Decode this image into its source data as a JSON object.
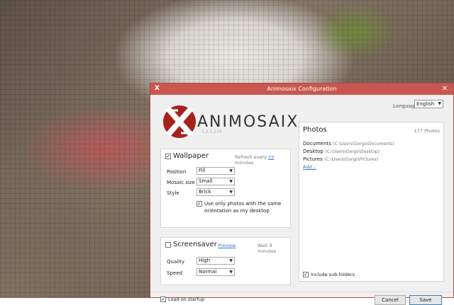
{
  "window": {
    "title": "Animosaix Configuration",
    "icon_label": "X",
    "close_label": "✕"
  },
  "language": {
    "label": "Language",
    "value": "English"
  },
  "logo": {
    "name": "ANIMOSAIX",
    "version": "1.2.1.174"
  },
  "wallpaper": {
    "checked": true,
    "title": "Wallpaper",
    "refresh_prefix": "Refresh every",
    "refresh_value": "15",
    "refresh_suffix": "minutes",
    "position_label": "Position",
    "position_value": "Fill",
    "mosaic_label": "Mosaic size",
    "mosaic_value": "Small",
    "style_label": "Style",
    "style_value": "Brick",
    "orientation_checked": true,
    "orientation_line1": "Use only photos with the same",
    "orientation_line2": "orientation as my desktop"
  },
  "screensaver": {
    "checked": false,
    "title": "Screensaver",
    "preview_label": "Preview",
    "wait_prefix": "Wait",
    "wait_value": "9",
    "wait_suffix": "minutes",
    "quality_label": "Quality",
    "quality_value": "High",
    "speed_label": "Speed",
    "speed_value": "Normal"
  },
  "photos": {
    "title": "Photos",
    "count": "177 Photos",
    "folders": [
      {
        "name": "Documents",
        "path": "(C:\\Users\\Gorgo\\Documents)"
      },
      {
        "name": "Desktop",
        "path": "(C:\\Users\\Gorgo\\Desktop)"
      },
      {
        "name": "Pictures",
        "path": "(C:\\Users\\Gorgo\\Pictures)"
      }
    ],
    "add_label": "Add...",
    "subfolders_checked": true,
    "subfolders_label": "Include sub-folders"
  },
  "footer": {
    "startup_checked": true,
    "startup_label": "Load on startup",
    "cancel_label": "Cancel",
    "save_label": "Save"
  },
  "colors": {
    "title_bar": "#c9574f",
    "link": "#3b76c5",
    "logo_red": "#a8221d"
  }
}
